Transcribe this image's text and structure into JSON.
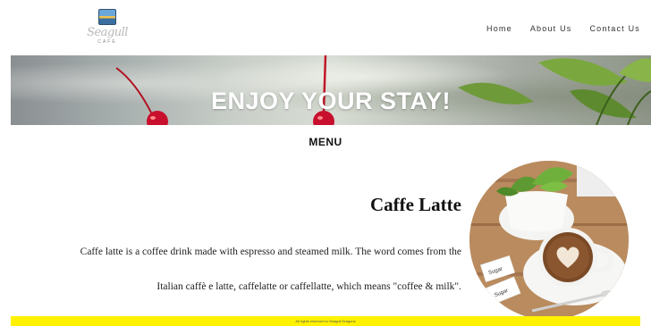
{
  "brand": {
    "logo_script": "Seagull",
    "logo_sub": "CAFE"
  },
  "nav": {
    "items": [
      "Home",
      "About Us",
      "Contact Us"
    ]
  },
  "hero": {
    "title": "ENJOY YOUR STAY!"
  },
  "menu": {
    "heading": "MENU"
  },
  "product": {
    "title": "Caffe Latte",
    "desc_line1": "Caffe latte is a coffee drink made with espresso and steamed milk. The word comes from the",
    "desc_line2": "Italian caffè e latte, caffelatte or caffellatte, which means \"coffee & milk\".",
    "photo_labels": [
      "Sugar",
      "Sugar"
    ]
  },
  "footer": {
    "text": "All rights reserved to Seagull Dragons"
  },
  "colors": {
    "footer_bg": "#fff200",
    "hero_text": "#ffffff",
    "cherry": "#c8102e"
  }
}
